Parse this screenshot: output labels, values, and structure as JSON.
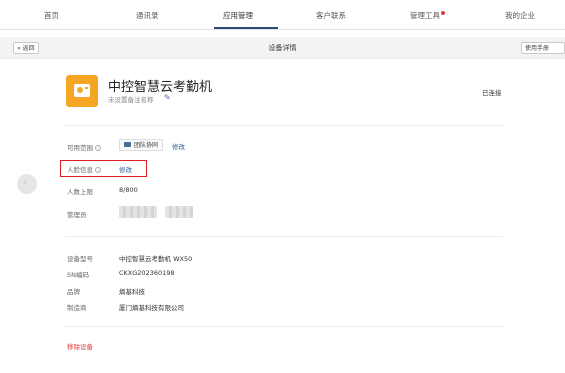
{
  "nav": {
    "items": [
      "首页",
      "通讯录",
      "应用管理",
      "客户联系",
      "管理工具",
      "我的企业"
    ],
    "active": "应用管理"
  },
  "subbar": {
    "back_label": "« 返回",
    "title": "设备详情",
    "manual_label": "使用手册"
  },
  "device": {
    "name": "中控智慧云考勤机",
    "alias": "未设置备注名称",
    "status": "已连接",
    "icon": "attendance-machine-icon",
    "icon_color": "#f5a623"
  },
  "settings": {
    "range_label": "可用范围",
    "range_value": "团队协同",
    "range_edit": "修改",
    "face_label": "人脸信息",
    "face_action": "修改",
    "capacity_label": "人数上限",
    "capacity_value": "8/800",
    "admin_label": "管理员"
  },
  "specs": {
    "model_label": "设备型号",
    "model_value": "中控智慧云考勤机 WX50",
    "sn_label": "SN编码",
    "sn_value": "CKXG202360198",
    "brand_label": "品牌",
    "brand_value": "熵基科技",
    "maker_label": "制造商",
    "maker_value": "厦门熵基科技有限公司"
  },
  "remove_label": "移除设备",
  "colors": {
    "accent": "#2b4a6f",
    "link": "#2a5a9a",
    "danger": "#e33b3b",
    "highlight_box": "#e02020"
  }
}
